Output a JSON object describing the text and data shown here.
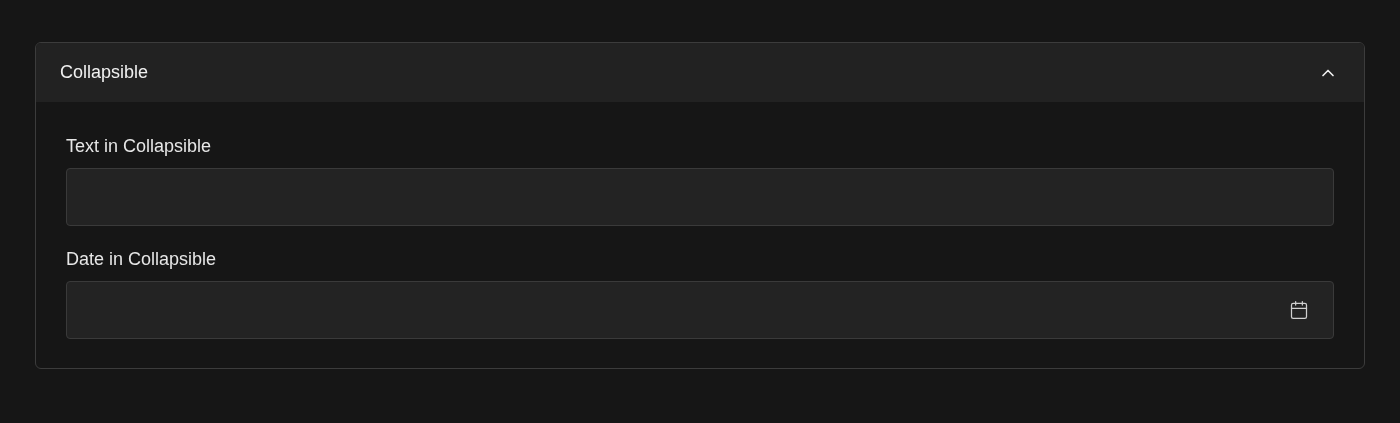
{
  "section": {
    "title": "Collapsible",
    "expanded": true
  },
  "fields": [
    {
      "kind": "text",
      "label": "Text in Collapsible"
    },
    {
      "kind": "date",
      "label": "Date in Collapsible"
    }
  ]
}
